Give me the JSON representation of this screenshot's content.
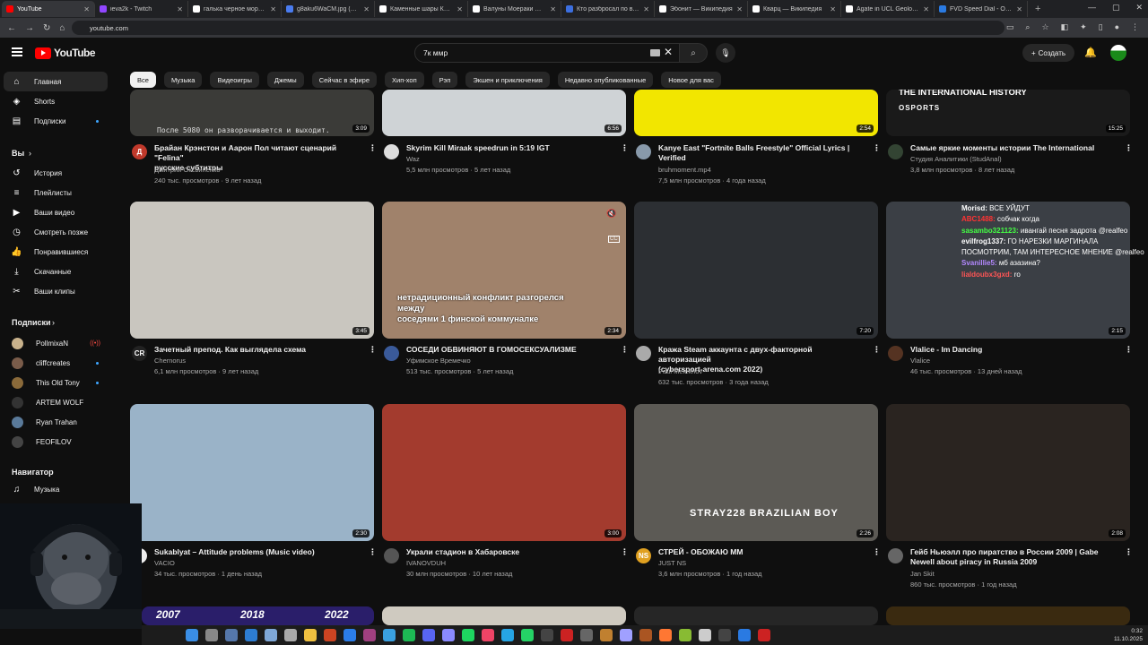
{
  "tabs": [
    {
      "label": "YouTube",
      "color": "#ff0000",
      "active": true
    },
    {
      "label": "ieva2k - Twitch",
      "color": "#9146ff"
    },
    {
      "label": "галька черное море - П",
      "color": "#ffffff"
    },
    {
      "label": "g8aku6WaCM.jpg (1280×",
      "color": "#4a7cf0"
    },
    {
      "label": "Каменные шары Коста-Р",
      "color": "#ffffff"
    },
    {
      "label": "Валуны Моераки — Вики",
      "color": "#ffffff"
    },
    {
      "label": "Кто разбросал по всему",
      "color": "#3c6fe0"
    },
    {
      "label": "Эбонит — Википедия",
      "color": "#ffffff"
    },
    {
      "label": "Кварц — Википедия",
      "color": "#ffffff"
    },
    {
      "label": "Agate in UCL Geology Co",
      "color": "#ffffff"
    },
    {
      "label": "FVD Speed Dial - Основ",
      "color": "#2a7ae2"
    }
  ],
  "url": "youtube.com",
  "search": {
    "value": "7к ммр"
  },
  "header": {
    "logo": "YouTube",
    "create": "Создать"
  },
  "sidebar": {
    "main": [
      {
        "label": "Главная",
        "icon": "⌂"
      },
      {
        "label": "Shorts",
        "icon": "◈"
      },
      {
        "label": "Подписки",
        "icon": "▤"
      }
    ],
    "you_header": "Вы",
    "you": [
      {
        "label": "История",
        "icon": "↺"
      },
      {
        "label": "Плейлисты",
        "icon": "≡"
      },
      {
        "label": "Ваши видео",
        "icon": "▶"
      },
      {
        "label": "Смотреть позже",
        "icon": "◷"
      },
      {
        "label": "Понравившиеся",
        "icon": "👍"
      },
      {
        "label": "Скачанные",
        "icon": "⤓"
      },
      {
        "label": "Ваши клипы",
        "icon": "✂"
      }
    ],
    "subs_header": "Подписки",
    "subs": [
      {
        "label": "PollmixaN",
        "color": "#c9b28c"
      },
      {
        "label": "cliffcreates",
        "color": "#7a5c4a"
      },
      {
        "label": "This Old Tony",
        "color": "#8a6a3a"
      },
      {
        "label": "ARTEM WOLF",
        "color": "#333333"
      },
      {
        "label": "Ryan Trahan",
        "color": "#5a7a9a"
      },
      {
        "label": "FEOFILOV",
        "color": "#444444"
      }
    ],
    "nav_header": "Навигатор",
    "nav": [
      {
        "label": "Музыка",
        "icon": "♫"
      }
    ]
  },
  "chips": [
    "Все",
    "Музыка",
    "Видеоигры",
    "Джемы",
    "Сейчас в эфире",
    "Хип-хоп",
    "Рэп",
    "Экшен и приключения",
    "Недавно опубликованные",
    "Новое для вас"
  ],
  "row1": [
    {
      "title": "Брайан Крэнстон и Аарон Пол читают сценарий \"Felina\"",
      "title2": "русские субтитры",
      "channel": "Дмитрий Оксвиненко",
      "meta": "240 тыс. просмотров · 9 лет назад",
      "duration": "3:09",
      "thumb_text": "После 5080 он разворачивается и выходит.",
      "avatar": "#c0392b",
      "avatar_letter": "Д"
    },
    {
      "title": "Skyrim Kill Miraak speedrun in 5:19 IGT",
      "title2": "",
      "channel": "Waz",
      "meta": "5,5 млн просмотров · 5 лет назад",
      "duration": "6:56",
      "avatar": "#dddddd"
    },
    {
      "title": "Kanye East \"Fortnite Balls Freestyle\" Official Lyrics |",
      "title2": "Verified",
      "channel": "bruhmoment.mp4",
      "meta": "7,5 млн просмотров · 4 года назад",
      "duration": "2:54",
      "avatar": "#8899aa"
    },
    {
      "title": "Самые яркие моменты истории The International",
      "title2": "",
      "channel": "Студия Аналитики (StudAnal)",
      "meta": "3,8 млн просмотров · 8 лет назад",
      "duration": "15:25",
      "thumb_text": "THE INTERNATIONAL HISTORY",
      "thumb_text2": "OSPORTS",
      "avatar": "#334433"
    }
  ],
  "row2": [
    {
      "title": "Зачетный препод. Как выглядела схема",
      "title2": "",
      "channel": "Chernorus",
      "meta": "6,1 млн просмотров · 9 лет назад",
      "duration": "3:45",
      "avatar": "#222222",
      "avatar_letter": "CR"
    },
    {
      "title": "СОСЕДИ ОБВИНЯЮТ В ГОМОСЕКСУАЛИЗМЕ",
      "title2": "",
      "channel": "Уфимское Времечко",
      "meta": "513 тыс. просмотров · 5 лет назад",
      "duration": "2:34",
      "overlay": [
        "нетрадиционный конфликт разгорелся",
        "между",
        "соседями 1 финской коммуналке"
      ],
      "avatar": "#3a5a9a"
    },
    {
      "title": "Кража Steam аккаунта с двух-факторной авторизацией",
      "title2": "(cybersport-arena.com 2022)",
      "channel": "Paul Melekhov",
      "meta": "632 тыс. просмотров · 3 года назад",
      "duration": "7:20",
      "avatar": "#aaaaaa"
    },
    {
      "title": "Vlalice - Im Dancing",
      "title2": "",
      "channel": "Vlalice",
      "meta": "46 тыс. просмотров · 13 дней назад",
      "duration": "2:15",
      "avatar": "#553322"
    }
  ],
  "chat": [
    {
      "user": "Morisd:",
      "text": "ВСЕ УЙДУТ",
      "color": "#ffffff"
    },
    {
      "user": "ABC1488:",
      "text": "собчак когда",
      "color": "#ff3333"
    },
    {
      "user": "sasambo321123:",
      "text": "ивангай песня задрота @realfeo",
      "color": "#44ff44"
    },
    {
      "user": "evilfrog1337:",
      "text": "ГО НАРЕЗКИ МАРГИНАЛА ПОСМОТРИМ, ТАМ ИНТЕРЕСНОЕ МНЕНИЕ @realfeo",
      "color": "#ffffff"
    },
    {
      "user": "Svanillie5:",
      "text": "мб азазина?",
      "color": "#b388ff"
    },
    {
      "user": "lialdoubx3gxd:",
      "text": "ro",
      "color": "#ff5555"
    }
  ],
  "row3": [
    {
      "title": "Sukablyat – Attitude problems (Music video)",
      "title2": "",
      "channel": "VACIO",
      "meta": "34 тыс. просмотров · 1 день назад",
      "duration": "2:30",
      "avatar": "#eeeeee"
    },
    {
      "title": "Украли стадион в Хабаровске",
      "title2": "",
      "channel": "IVANOVDUH",
      "meta": "30 млн просмотров · 10 лет назад",
      "duration": "3:00",
      "avatar": "#555555"
    },
    {
      "title": "СТРЕЙ - ОБОЖАЮ ММ",
      "title2": "",
      "channel": "JUST NS",
      "meta": "3,6 млн просмотров · 1 год назад",
      "duration": "2:26",
      "thumb_text": "STRAY228 BRAZILIAN BOY",
      "avatar": "#e0a020",
      "avatar_letter": "NS"
    },
    {
      "title": "Гейб Ньюэлл про пиратство в России 2009 | Gabe",
      "title2": "Newell about piracy in Russia 2009",
      "channel": "Jan Skit",
      "meta": "860 тыс. просмотров · 1 год назад",
      "duration": "2:08",
      "avatar": "#666666"
    }
  ],
  "row4_labels": [
    "2007",
    "2018",
    "2022"
  ],
  "clock": {
    "time": "0:32",
    "date": "11.10.2025"
  }
}
